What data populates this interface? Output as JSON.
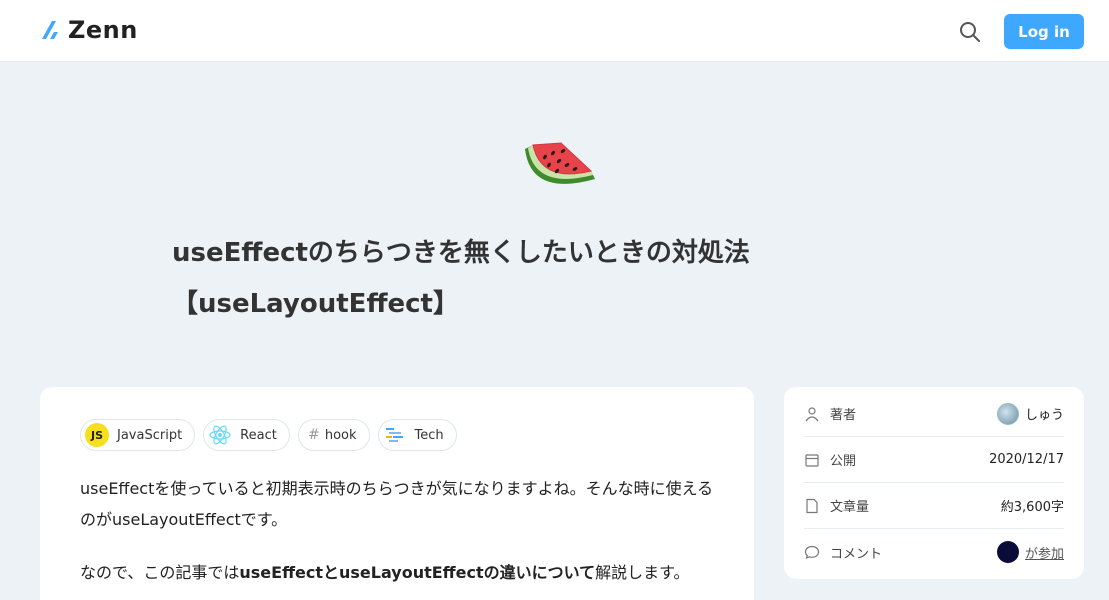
{
  "header": {
    "logo_text": "Zenn",
    "login_label": "Log in"
  },
  "article": {
    "emoji": "🍉",
    "title_line1": "useEffectのちらつきを無くしたいときの対処法",
    "title_line2": "【useLayoutEffect】",
    "topics": [
      {
        "label": "JavaScript",
        "icon": "js-icon",
        "icon_text": "JS"
      },
      {
        "label": "React",
        "icon": "react-icon"
      },
      {
        "label": "hook",
        "icon": "hash-icon",
        "icon_text": "#"
      },
      {
        "label": "Tech",
        "icon": "tech-icon"
      }
    ],
    "para1": "useEffectを使っていると初期表示時のちらつきが気になりますよね。そんな時に使えるのがuseLayoutEffectです。",
    "para2_pre": "なので、この記事では",
    "para2_bold": "useEffectとuseLayoutEffectの違いについて",
    "para2_post": "解説します。"
  },
  "sidebar": {
    "author_label": "著者",
    "author_name": "しゅう",
    "published_label": "公開",
    "published_value": "2020/12/17",
    "length_label": "文章量",
    "length_value": "約3,600字",
    "comment_label": "コメント",
    "comment_value": "が参加"
  },
  "colors": {
    "brand": "#3ea8ff",
    "background": "#edf2f7"
  }
}
